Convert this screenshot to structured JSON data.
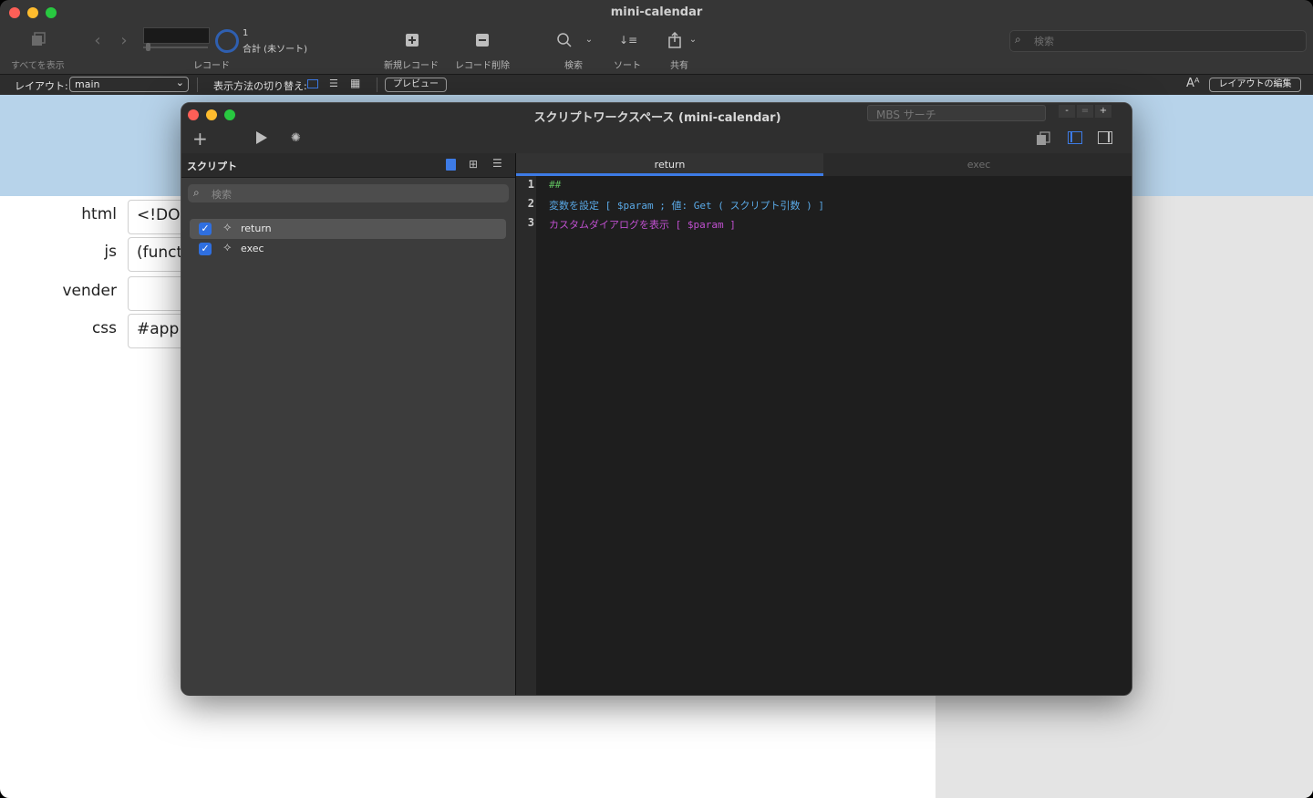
{
  "window": {
    "title": "mini-calendar"
  },
  "toolbar": {
    "show_all": "すべてを表示",
    "record_label": "レコード",
    "record_number": "1",
    "record_total": "合計 (未ソート)",
    "new_record": "新規レコード",
    "delete_record": "レコード削除",
    "find": "検索",
    "sort": "ソート",
    "share": "共有",
    "search_placeholder": "検索"
  },
  "layoutbar": {
    "layout_label": "レイアウト:",
    "layout_value": "main",
    "view_as_label": "表示方法の切り替え:",
    "preview_button": "プレビュー",
    "edit_layout_button": "レイアウトの編集"
  },
  "form": {
    "fields": [
      {
        "label": "html",
        "value": "<!DOC"
      },
      {
        "label": "js",
        "value": "(funct"
      },
      {
        "label": "vender",
        "value": ""
      },
      {
        "label": "css",
        "value": "#app{f"
      }
    ]
  },
  "script_workspace": {
    "title": "スクリプトワークスペース (mini-calendar)",
    "mbs_search_placeholder": "MBS サーチ",
    "zoom": {
      "minus": "-",
      "equal": "=",
      "plus": "+"
    },
    "scripts_header": "スクリプト",
    "scripts_search_placeholder": "検索",
    "scripts": [
      {
        "name": "return",
        "checked": true,
        "selected": true
      },
      {
        "name": "exec",
        "checked": true,
        "selected": false
      }
    ],
    "tabs": [
      {
        "label": "return",
        "active": true
      },
      {
        "label": "exec",
        "active": false
      }
    ],
    "code_lines": [
      {
        "num": "1",
        "text": "##",
        "color": "#5fbf5f"
      },
      {
        "num": "2",
        "text": "変数を設定 [ $param ; 値: Get ( スクリプト引数 ) ]",
        "color": "#5aa9e6"
      },
      {
        "num": "3",
        "text": "カスタムダイアログを表示 [ $param ]",
        "color": "#c050d0"
      }
    ]
  },
  "colors": {
    "accent": "#2f6fe0",
    "header_band": "#b7d3ea"
  }
}
